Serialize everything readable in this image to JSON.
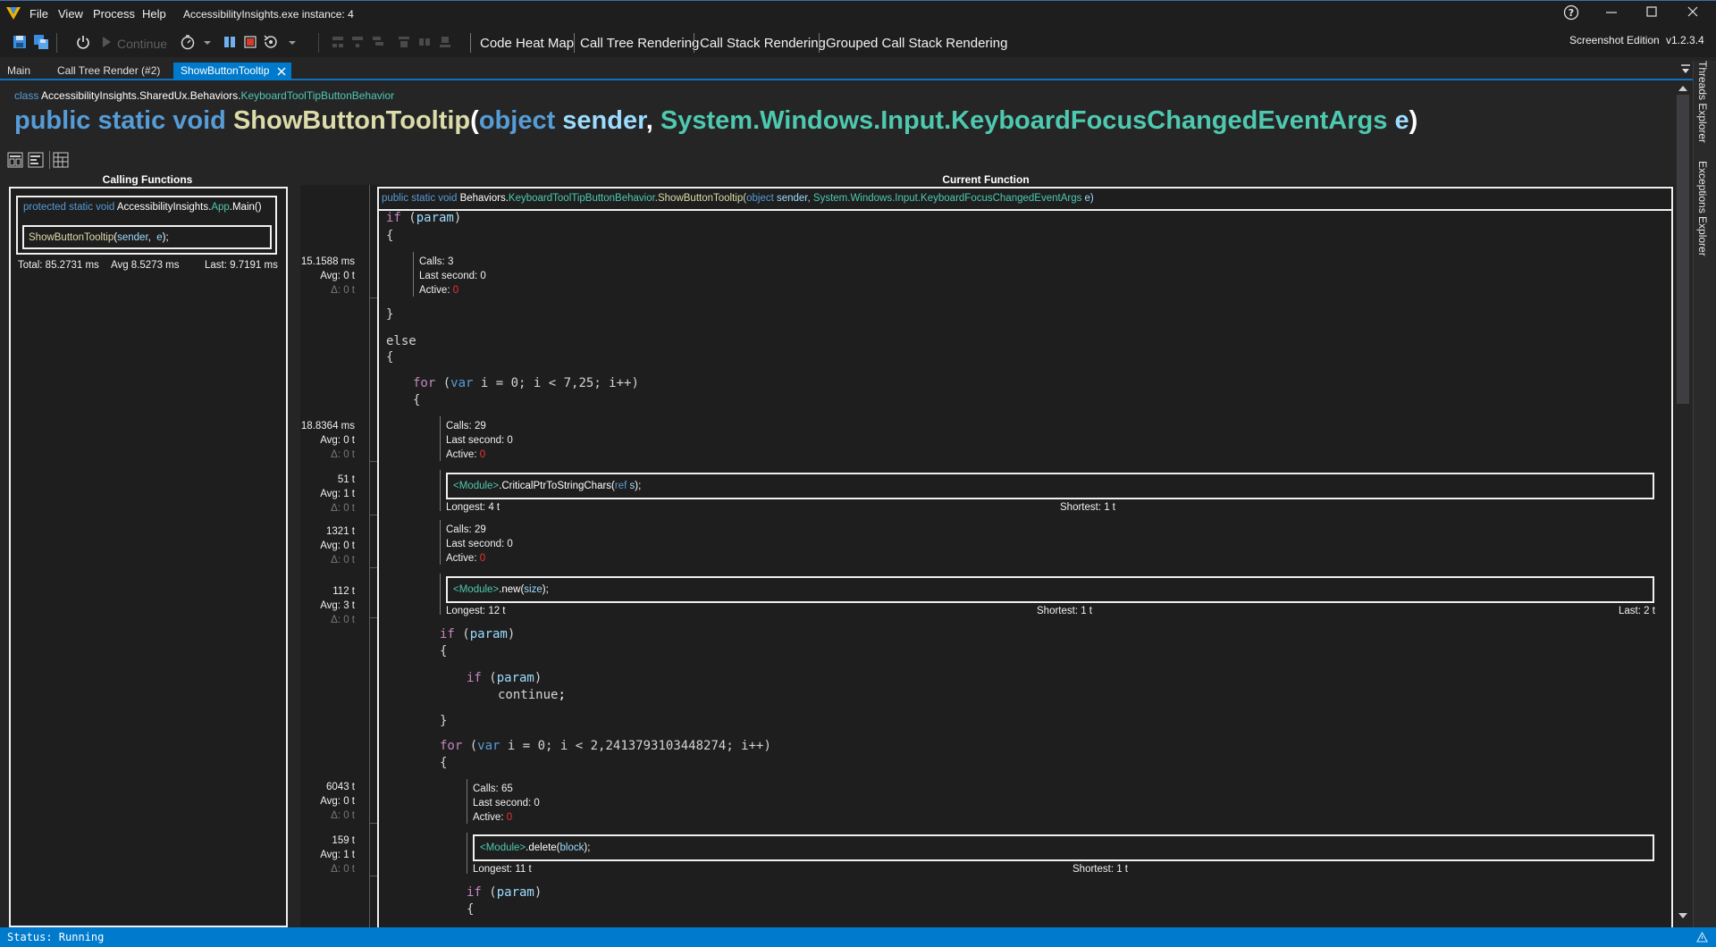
{
  "app": {
    "instance_title": "AccessibilityInsights.exe instance: 4",
    "edition": "Screenshot Edition",
    "version": "v1.2.3.4",
    "menu": [
      "File",
      "View",
      "Process",
      "Help"
    ]
  },
  "toolbar": {
    "continue_label": "Continue",
    "buttons": [
      "Code Heat Map",
      "Call Tree Rendering",
      "Call Stack Rendering",
      "Grouped Call Stack Rendering"
    ]
  },
  "tabs": [
    "Main",
    "Call Tree Render (#2)",
    "ShowButtonTooltip"
  ],
  "side_tabs": [
    "Threads Explorer",
    "Exceptions Explorer"
  ],
  "header": {
    "class_kw": "class",
    "class_ns": "AccessibilityInsights.SharedUx.Behaviors.",
    "class_name": "KeyboardToolTipButtonBehavior",
    "sig": {
      "modifiers": "public static void ",
      "name": "ShowButtonTooltip",
      "open": "(",
      "p1_type": "object",
      "p1_name": " sender",
      "comma": ", ",
      "p2_type": "System.Windows.Input.KeyboardFocusChangedEventArgs",
      "p2_name": " e",
      "close": ")"
    }
  },
  "calling": {
    "title": "Calling Functions",
    "caller_mod": "protected static void ",
    "caller_ns": "AccessibilityInsights.",
    "caller_cls": "App",
    "caller_fn": ".Main()",
    "call_fn": "ShowButtonTooltip",
    "call_open": "(",
    "call_a1": "sender",
    "call_sep": ",  ",
    "call_a2": "e",
    "call_close": ");",
    "total": "Total: 85.2731 ms",
    "avg": "Avg 8.5273 ms",
    "last": "Last: 9.7191 ms"
  },
  "current": {
    "title": "Current Function",
    "sig_mod": "public static void ",
    "sig_cls1": "Behaviors.",
    "sig_cls2": "KeyboardToolTipButtonBehavior",
    "sig_fn": ".ShowButtonTooltip(",
    "sig_p1t": "object",
    "sig_p1n": " sender, ",
    "sig_p2t": "System.Windows.Input.KeyboardFocusChangedEventArgs",
    "sig_p2n": " e)"
  },
  "code": {
    "if_kw": "if",
    "param": "param",
    "else_kw": "else",
    "for_kw": "for",
    "var_kw": "var",
    "continue_kw": "continue",
    "for1_rest": " i = 0; i < 7,25; i++)",
    "for2_rest": " i = 0; i < 2,2413793103448274; i++)",
    "lbrace": "{",
    "rbrace": "}"
  },
  "timings": [
    {
      "v": "15.1588 ms",
      "avg": "Avg: 0 t",
      "d": "Δ: 0 t"
    },
    {
      "v": "18.8364 ms",
      "avg": "Avg: 0 t",
      "d": "Δ: 0 t"
    },
    {
      "v": "51 t",
      "avg": "Avg: 1 t",
      "d": "Δ: 0 t"
    },
    {
      "v": "1321 t",
      "avg": "Avg: 0 t",
      "d": "Δ: 0 t"
    },
    {
      "v": "112 t",
      "avg": "Avg: 3 t",
      "d": "Δ: 0 t"
    },
    {
      "v": "6043 t",
      "avg": "Avg: 0 t",
      "d": "Δ: 0 t"
    },
    {
      "v": "159 t",
      "avg": "Avg: 1 t",
      "d": "Δ: 0 t"
    }
  ],
  "stats": [
    {
      "calls": "Calls:  3",
      "last_second": "Last second:  0",
      "active_label": "Active:  ",
      "active_val": "0"
    },
    {
      "calls": "Calls:  29",
      "last_second": "Last second:  0",
      "active_label": "Active:  ",
      "active_val": "0"
    },
    {
      "calls": "Calls:  29",
      "last_second": "Last second:  0",
      "active_label": "Active:  ",
      "active_val": "0"
    },
    {
      "calls": "Calls:  65",
      "last_second": "Last second:  0",
      "active_label": "Active:  ",
      "active_val": "0"
    }
  ],
  "calls": [
    {
      "module": "<Module>",
      "fn": ".CriticalPtrToStringChars(",
      "arg_kw": "ref",
      "arg": " s",
      "end": ");",
      "longest": "Longest:  4 t",
      "shortest": "Shortest:  1 t",
      "last": ""
    },
    {
      "module": "<Module>",
      "fn": ".new(",
      "arg_kw": "",
      "arg": "size",
      "end": ");",
      "longest": "Longest:  12 t",
      "shortest": "Shortest:  1 t",
      "last": "Last: 2 t"
    },
    {
      "module": "<Module>",
      "fn": ".delete(",
      "arg_kw": "",
      "arg": "block",
      "end": ");",
      "longest": "Longest:  11 t",
      "shortest": "Shortest:  1 t",
      "last": ""
    }
  ],
  "status": "Status: Running"
}
